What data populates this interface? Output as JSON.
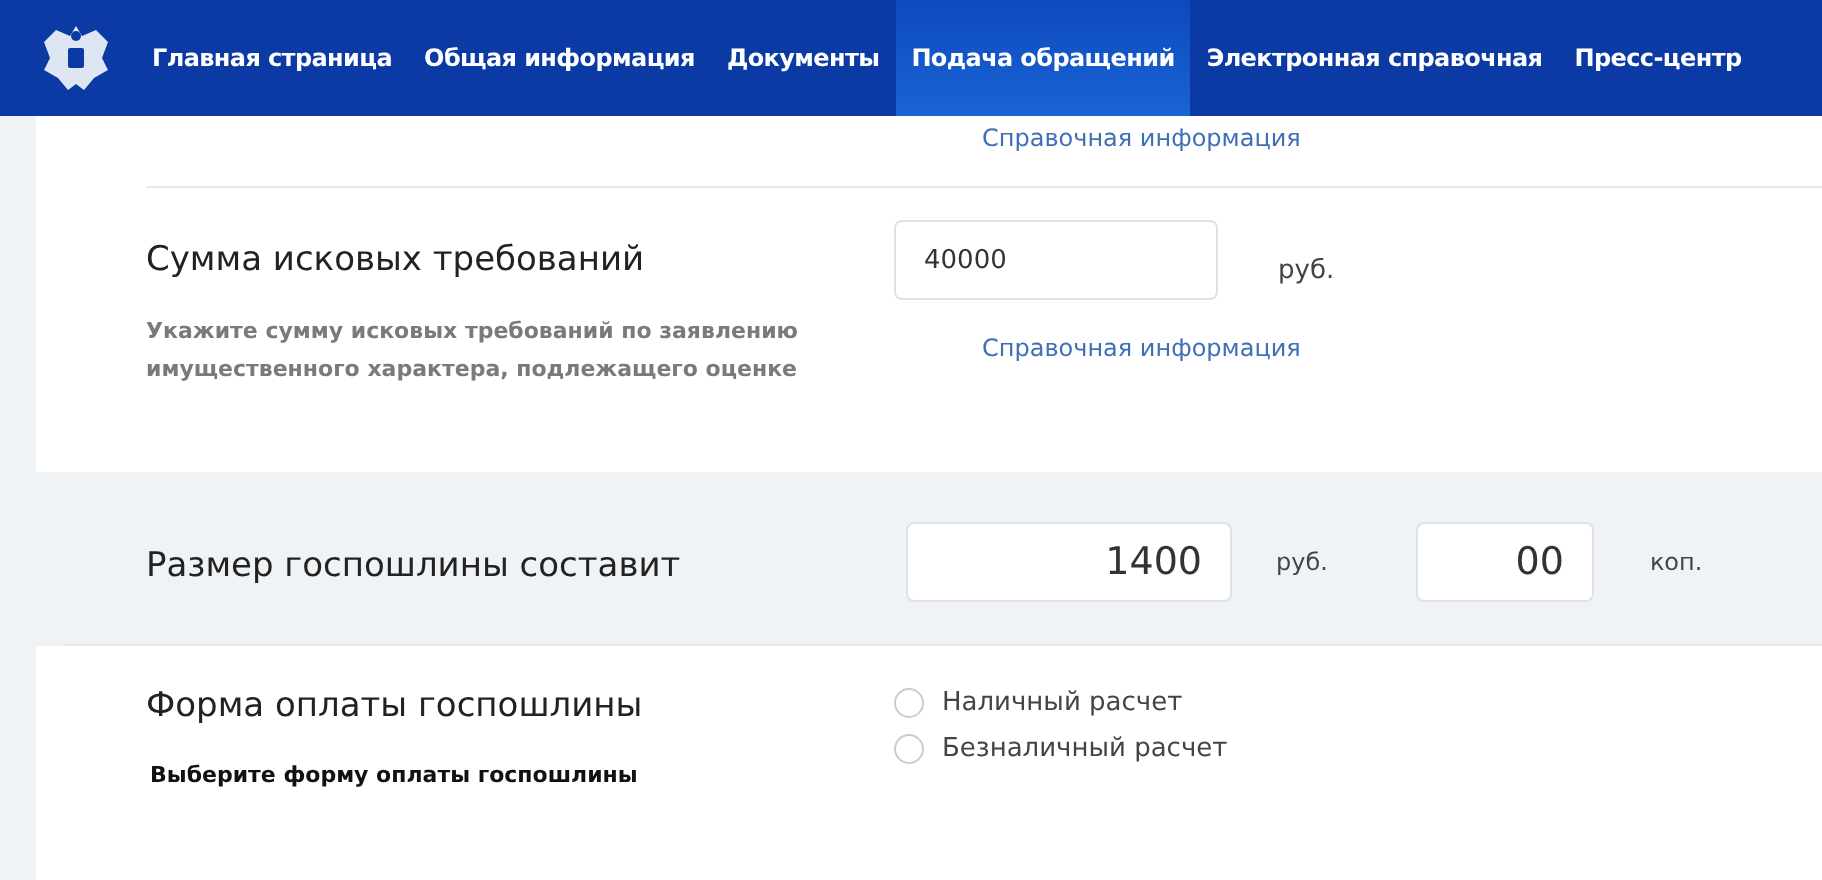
{
  "nav": {
    "items": [
      {
        "label": "Главная страница",
        "selected": false
      },
      {
        "label": "Общая информация",
        "selected": false
      },
      {
        "label": "Документы",
        "selected": false
      },
      {
        "label": "Подача обращений",
        "selected": true
      },
      {
        "label": "Электронная справочная",
        "selected": false
      },
      {
        "label": "Пресс-центр",
        "selected": false
      }
    ]
  },
  "top_link": "Справочная информация",
  "claim": {
    "title": "Сумма исковых требований",
    "value": "40000",
    "unit": "руб.",
    "hint": "Укажите сумму исковых требований по заявлению имущественного характера, подлежащего оценке",
    "link": "Справочная информация"
  },
  "fee": {
    "title": "Размер госпошлины составит",
    "rubles": "1400",
    "rub_unit": "руб.",
    "kopecks": "00",
    "kop_unit": "коп."
  },
  "payment": {
    "title": "Форма оплаты госпошлины",
    "hint": "Выберите форму оплаты госпошлины",
    "options": [
      {
        "label": "Наличный расчет",
        "selected": false
      },
      {
        "label": "Безналичный расчет",
        "selected": false
      }
    ]
  }
}
